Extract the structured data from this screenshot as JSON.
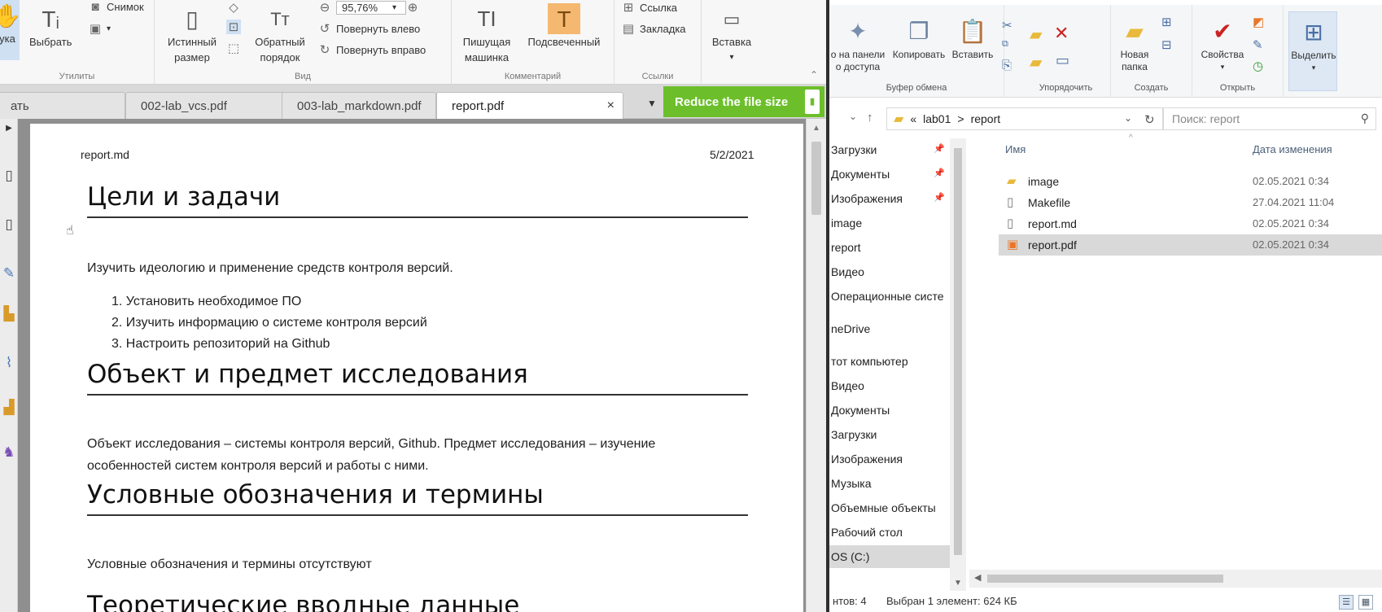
{
  "pdf_viewer": {
    "ribbon": {
      "utilities": {
        "label": "Утилиты",
        "hand_label": "ука",
        "select_label": "Выбрать",
        "snapshot_label": "Снимок"
      },
      "view": {
        "label": "Вид",
        "actual_size_label": "Истинный размер",
        "reverse_order_label": "Обратный порядок",
        "zoom_value": "95,76%",
        "rotate_left_label": "Повернуть влево",
        "rotate_right_label": "Повернуть вправо"
      },
      "comment": {
        "label": "Комментарий",
        "typewriter_label": "Пишущая машинка",
        "highlight_label": "Подсвеченный"
      },
      "links": {
        "label": "Ссылки",
        "link_label": "Ссылка",
        "bookmark_label": "Закладка"
      },
      "insert_label": "Вставка"
    },
    "tabs": [
      {
        "label": "ать"
      },
      {
        "label": "002-lab_vcs.pdf"
      },
      {
        "label": "003-lab_markdown.pdf"
      },
      {
        "label": "report.pdf",
        "close": "×"
      }
    ],
    "reduce_button": "Reduce the file size",
    "document": {
      "header_left": "report.md",
      "header_right": "5/2/2021",
      "sections": [
        {
          "title": "Цели и задачи"
        },
        {
          "title": "Объект и предмет исследования"
        },
        {
          "title": "Условные обозначения и термины"
        },
        {
          "title": "Теоретические вводные данные"
        }
      ],
      "goals_intro": "Изучить идеологию и применение средств контроля версий.",
      "goals_list": [
        "1. Установить необходимое ПО",
        "2. Изучить информацию о системе контроля версий",
        "3. Настроить репозиторий на Github"
      ],
      "object_text_1": "Объект исследования – системы контроля версий, Github. Предмет исследования – изучение",
      "object_text_2": "особенностей систем контроля версий и работы с ними.",
      "terms_text": "Условные обозначения и термины отсутствуют"
    }
  },
  "explorer": {
    "ribbon": {
      "clipboard": {
        "label": "Буфер обмена",
        "pin_label": "о на панели\nо доступа",
        "copy_label": "Копировать",
        "paste_label": "Вставить"
      },
      "organize": {
        "label": "Упорядочить"
      },
      "create": {
        "label": "Создать",
        "new_folder_label": "Новая\nпапка"
      },
      "open": {
        "label": "Открыть",
        "properties_label": "Свойства"
      },
      "select": {
        "label": "Выделить"
      }
    },
    "address": {
      "path_root": "lab01",
      "path_current": "report",
      "separator": ">",
      "overflow": "«",
      "search_placeholder": "Поиск: report"
    },
    "nav_items": [
      {
        "label": "Загрузки",
        "pinned": true
      },
      {
        "label": "Документы",
        "pinned": true
      },
      {
        "label": "Изображения",
        "pinned": true
      },
      {
        "label": "image"
      },
      {
        "label": "report"
      },
      {
        "label": "Видео"
      },
      {
        "label": "Операционные систе"
      },
      {
        "label": "neDrive"
      },
      {
        "label": "тот компьютер"
      },
      {
        "label": "Видео"
      },
      {
        "label": "Документы"
      },
      {
        "label": "Загрузки"
      },
      {
        "label": "Изображения"
      },
      {
        "label": "Музыка"
      },
      {
        "label": "Объемные объекты"
      },
      {
        "label": "Рабочий стол"
      },
      {
        "label": "OS (C:)",
        "selected": true
      }
    ],
    "columns": {
      "name": "Имя",
      "date": "Дата изменения"
    },
    "files": [
      {
        "name": "image",
        "date": "02.05.2021 0:34",
        "icon": "folder-icon"
      },
      {
        "name": "Makefile",
        "date": "27.04.2021 11:04",
        "icon": "file-icon"
      },
      {
        "name": "report.md",
        "date": "02.05.2021 0:34",
        "icon": "file-icon"
      },
      {
        "name": "report.pdf",
        "date": "02.05.2021 0:34",
        "icon": "pdf-file-icon",
        "selected": true
      }
    ],
    "status": {
      "count": "нтов: 4",
      "selection": "Выбран 1 элемент: 624 КБ"
    }
  },
  "colors": {
    "reduce_button": "#6cbf2a",
    "folder": "#e8b93a",
    "selection": "#d9d9d9"
  }
}
